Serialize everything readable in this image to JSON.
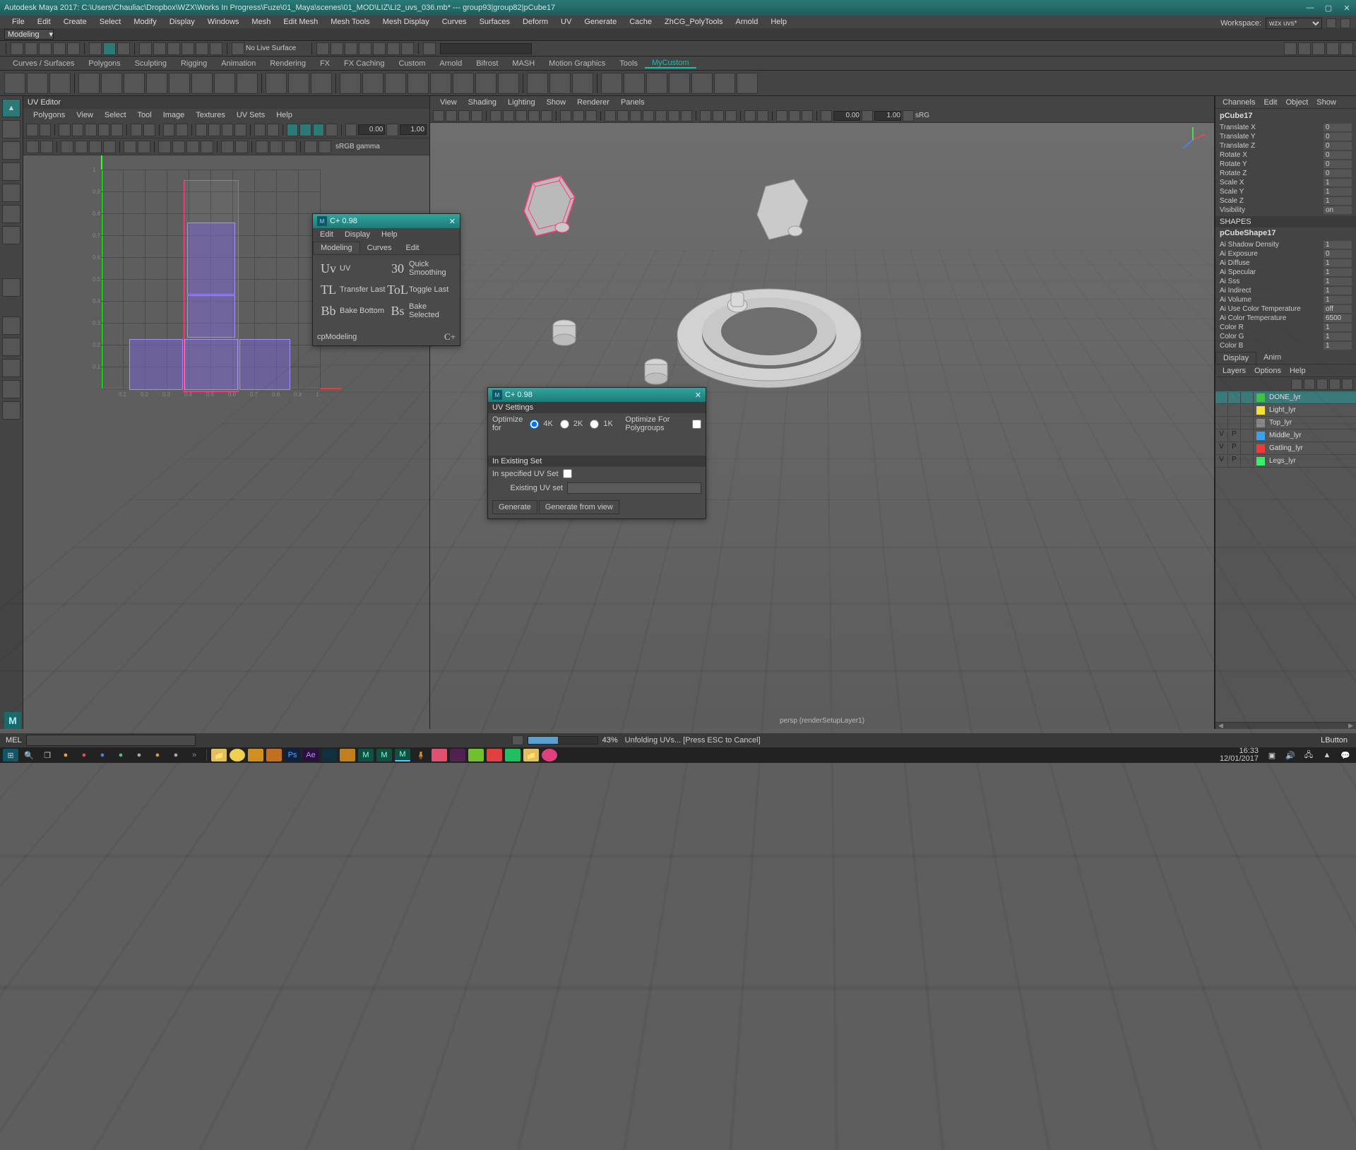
{
  "title": "Autodesk Maya 2017: C:\\Users\\Chauliac\\Dropbox\\WZX\\Works In Progress\\Fuze\\01_Maya\\scenes\\01_MOD\\LIZ\\LI2_uvs_036.mb*  ---  group93|group82|pCube17",
  "menubar": [
    "File",
    "Edit",
    "Create",
    "Select",
    "Modify",
    "Display",
    "Windows",
    "Mesh",
    "Edit Mesh",
    "Mesh Tools",
    "Mesh Display",
    "Curves",
    "Surfaces",
    "Deform",
    "UV",
    "Generate",
    "Cache",
    "ZhCG_PolyTools",
    "Arnold",
    "Help"
  ],
  "workspace_label": "Workspace:",
  "workspace_value": "wzx uvs*",
  "status_mode": "Modeling",
  "no_live": "No Live Surface",
  "shelf_tabs": [
    "Curves / Surfaces",
    "Polygons",
    "Sculpting",
    "Rigging",
    "Animation",
    "Rendering",
    "FX",
    "FX Caching",
    "Custom",
    "Arnold",
    "Bifrost",
    "MASH",
    "Motion Graphics",
    "Tools",
    "MyCustom"
  ],
  "shelf_active": "MyCustom",
  "uv_panel": {
    "title": "UV Editor",
    "menu": [
      "Polygons",
      "View",
      "Select",
      "Tool",
      "Image",
      "Textures",
      "UV Sets",
      "Help"
    ],
    "val1": "0.00",
    "val2": "1.00",
    "gamma": "sRGB gamma",
    "ticks": [
      "0.1",
      "0.2",
      "0.3",
      "0.4",
      "0.5",
      "0.6",
      "0.7",
      "0.8",
      "0.9",
      "1"
    ]
  },
  "viewport": {
    "menu": [
      "View",
      "Shading",
      "Lighting",
      "Show",
      "Renderer",
      "Panels"
    ],
    "val1": "0.00",
    "val2": "1.00",
    "cam": "sRG",
    "status": "persp (renderSetupLayer1)"
  },
  "channels": {
    "menu": [
      "Channels",
      "Edit",
      "Object",
      "Show"
    ],
    "obj": "pCube17",
    "attrs": [
      {
        "k": "Translate X",
        "v": "0"
      },
      {
        "k": "Translate Y",
        "v": "0"
      },
      {
        "k": "Translate Z",
        "v": "0"
      },
      {
        "k": "Rotate X",
        "v": "0"
      },
      {
        "k": "Rotate Y",
        "v": "0"
      },
      {
        "k": "Rotate Z",
        "v": "0"
      },
      {
        "k": "Scale X",
        "v": "1"
      },
      {
        "k": "Scale Y",
        "v": "1"
      },
      {
        "k": "Scale Z",
        "v": "1"
      },
      {
        "k": "Visibility",
        "v": "on"
      }
    ],
    "shapes_label": "SHAPES",
    "shape": "pCubeShape17",
    "shape_attrs": [
      {
        "k": "Ai Shadow Density",
        "v": "1"
      },
      {
        "k": "Ai Exposure",
        "v": "0"
      },
      {
        "k": "Ai Diffuse",
        "v": "1"
      },
      {
        "k": "Ai Specular",
        "v": "1"
      },
      {
        "k": "Ai Sss",
        "v": "1"
      },
      {
        "k": "Ai Indirect",
        "v": "1"
      },
      {
        "k": "Ai Volume",
        "v": "1"
      },
      {
        "k": "Ai Use Color Temperature",
        "v": "off"
      },
      {
        "k": "Ai Color Temperature",
        "v": "6500"
      },
      {
        "k": "Color R",
        "v": "1"
      },
      {
        "k": "Color G",
        "v": "1"
      },
      {
        "k": "Color B",
        "v": "1"
      }
    ],
    "subtabs": [
      "Display",
      "Anim"
    ],
    "layer_menu": [
      "Layers",
      "Options",
      "Help"
    ],
    "layers": [
      {
        "v": "",
        "p": "",
        "color": "#3fc23f",
        "name": "DONE_lyr",
        "sel": true
      },
      {
        "v": "",
        "p": "",
        "color": "#f5e03a",
        "name": "Light_lyr"
      },
      {
        "v": "",
        "p": "",
        "color": "",
        "name": "Top_lyr"
      },
      {
        "v": "V",
        "p": "P",
        "color": "#3aa0f0",
        "name": "Middle_lyr"
      },
      {
        "v": "V",
        "p": "P",
        "color": "#f03a3a",
        "name": "Gatling_lyr"
      },
      {
        "v": "V",
        "p": "P",
        "color": "#3af06a",
        "name": "Legs_lyr"
      }
    ]
  },
  "float1": {
    "title": "C+ 0.98",
    "menu": [
      "Edit",
      "Display",
      "Help"
    ],
    "tabs": [
      "Modeling",
      "Curves",
      "Edit"
    ],
    "rows": [
      {
        "a": "Uv",
        "al": "UV",
        "b": "30",
        "bl": "Quick Smoothing"
      },
      {
        "a": "TL",
        "al": "Transfer Last",
        "b": "ToL",
        "bl": "Toggle Last"
      },
      {
        "a": "Bb",
        "al": "Bake Bottom",
        "b": "Bs",
        "bl": "Bake Selected"
      }
    ],
    "foot": "cpModeling",
    "foot_r": "C+"
  },
  "float2": {
    "title": "C+ 0.98",
    "sec1": "UV Settings",
    "optimize_label": "Optimize for",
    "opts": [
      "4K",
      "2K",
      "1K"
    ],
    "optimize_pg": "Optimize For Polygroups",
    "sec2": "In Existing Set",
    "spec_label": "In specified UV Set",
    "field_label": "Existing UV set",
    "field_val": "",
    "btn1": "Generate",
    "btn2": "Generate from view"
  },
  "bottom": {
    "mel": "MEL",
    "pct": "43%",
    "unfold": "Unfolding UVs... [Press ESC to Cancel]",
    "rbtn": "LButton"
  },
  "clock": {
    "time": "16:33",
    "date": "12/01/2017"
  }
}
